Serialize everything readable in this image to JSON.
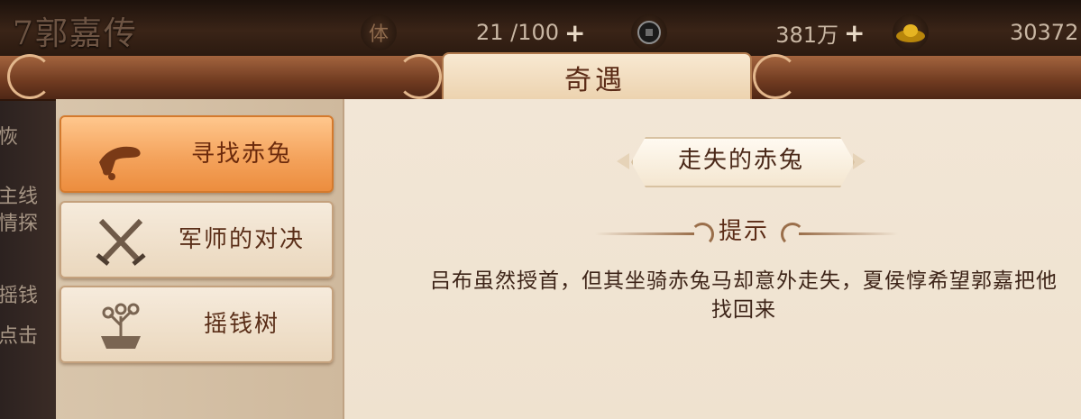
{
  "header": {
    "char_name": "7郭嘉传",
    "stamina_icon": "体",
    "stamina": "21 /100",
    "coin": "381万",
    "ingot": "30372",
    "plus": "+"
  },
  "sidebar_peek": [
    "恢",
    "主线",
    "情探",
    "摇钱",
    "点击"
  ],
  "window": {
    "title": "奇遇"
  },
  "tabs": [
    {
      "label": "寻找赤兔",
      "icon": "hand-icon"
    },
    {
      "label": "军师的对决",
      "icon": "crossed-swords-icon"
    },
    {
      "label": "摇钱树",
      "icon": "money-tree-icon"
    }
  ],
  "content": {
    "story_title": "走失的赤兔",
    "hint_title": "提示",
    "description": "吕布虽然授首，但其坐骑赤兔马却意外走失，夏侯惇希望郭嘉把他找回来"
  },
  "colors": {
    "active_tab": "#f4a35c",
    "banner": "#6f3a20",
    "parchment": "#f2e6d6"
  }
}
